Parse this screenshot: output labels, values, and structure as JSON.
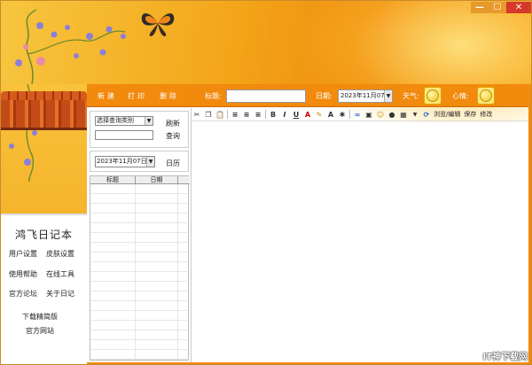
{
  "window": {
    "min_label": "—",
    "max_label": "☐",
    "close_label": "✕"
  },
  "toolbar": {
    "new_label": "新建",
    "print_label": "打印",
    "delete_label": "删除",
    "title_label": "标题:",
    "date_label": "日期:",
    "date_value": "2023年11月07日",
    "weather_label": "天气:",
    "mood_label": "心情:"
  },
  "query": {
    "category_select": "选择查询类别",
    "refresh_label": "刷新",
    "search_label": "查询",
    "date_value": "2023年11月07日",
    "calendar_label": "日历",
    "columns": [
      "标题",
      "日期"
    ]
  },
  "sidebar": {
    "app_title": "鸿飞日记本",
    "items": [
      {
        "label": "用户设置"
      },
      {
        "label": "皮肤设置"
      },
      {
        "label": "使用帮助"
      },
      {
        "label": "在线工具"
      },
      {
        "label": "官方论坛"
      },
      {
        "label": "关于日记"
      },
      {
        "label": "下载精简版"
      },
      {
        "label": "官方网站"
      }
    ]
  },
  "editor_toolbar": {
    "bold": "B",
    "italic": "I",
    "underline": "U",
    "font_color": "A",
    "font_size": "A",
    "browse_edit_label": "浏览/编辑",
    "save_label": "保存",
    "modify_label": "修改"
  },
  "watermark": "IT神下载网",
  "colors": {
    "accent": "#f18a0d",
    "banner": "#f3a417"
  }
}
